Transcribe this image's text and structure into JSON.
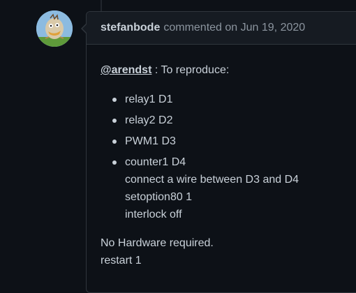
{
  "comment": {
    "author": "stefanbode",
    "action": "commented on",
    "date": "Jun 19, 2020",
    "mention": "@arendst",
    "intro": " : To reproduce:",
    "list": [
      {
        "lines": [
          "relay1 D1"
        ]
      },
      {
        "lines": [
          "relay2 D2"
        ]
      },
      {
        "lines": [
          "PWM1 D3"
        ]
      },
      {
        "lines": [
          "counter1 D4",
          "connect a wire between D3 and D4",
          "setoption80 1",
          "interlock off"
        ]
      }
    ],
    "closing": [
      "No Hardware required.",
      "restart 1"
    ]
  },
  "colors": {
    "background": "#0d1117",
    "header_background": "#161b22",
    "border": "#30363d",
    "text": "#c9d1d9",
    "muted": "#8b949e"
  }
}
